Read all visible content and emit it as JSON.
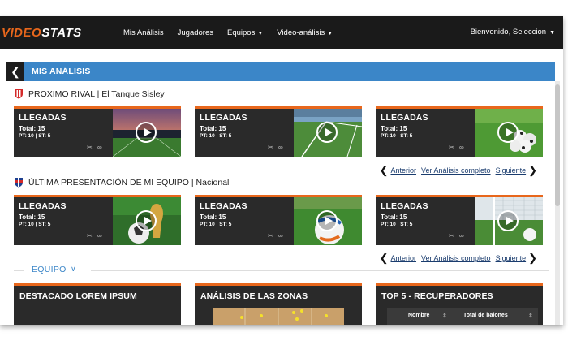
{
  "nav": {
    "logo_part1": "VIDEO",
    "logo_part2": "STATS",
    "items": [
      "Mis Análisis",
      "Jugadores",
      "Equipos",
      "Video-análisis"
    ],
    "user": "Bienvenido, Seleccion"
  },
  "panel": {
    "title": "MIS ANÁLISIS"
  },
  "sections": [
    {
      "title": "PROXIMO RIVAL | El Tanque Sisley"
    },
    {
      "title": "ÚLTIMA PRESENTACIÓN DE MI EQUIPO | Nacional"
    }
  ],
  "cards": [
    {
      "title": "LLEGADAS",
      "total": "Total: 15",
      "sub": "PT: 10 | ST: 5"
    },
    {
      "title": "LLEGADAS",
      "total": "Total: 15",
      "sub": "PT: 10 | ST: 5"
    },
    {
      "title": "LLEGADAS",
      "total": "Total: 15",
      "sub": "PT: 10 | ST: 5"
    },
    {
      "title": "LLEGADAS",
      "total": "Total: 15",
      "sub": "PT: 10 | ST: 5"
    },
    {
      "title": "LLEGADAS",
      "total": "Total: 15",
      "sub": "PT: 10 | ST: 5"
    },
    {
      "title": "LLEGADAS",
      "total": "Total: 15",
      "sub": "PT: 10 | ST: 5"
    }
  ],
  "pager": {
    "prev": "Anterior",
    "all": "Ver Análisis completo",
    "next": "Siguiente"
  },
  "equipo": {
    "label": "EQUIPO"
  },
  "bottom_cards": {
    "c1": "DESTACADO LOREM IPSUM",
    "c2": "ANÁLISIS DE LAS ZONAS",
    "c3": "TOP 5 - RECUPERADORES",
    "col1": "Nombre",
    "col2": "Total de balones"
  },
  "colors": {
    "accent": "#e8671c",
    "header_blue": "#3b86c8",
    "dark": "#2a2a2a"
  }
}
